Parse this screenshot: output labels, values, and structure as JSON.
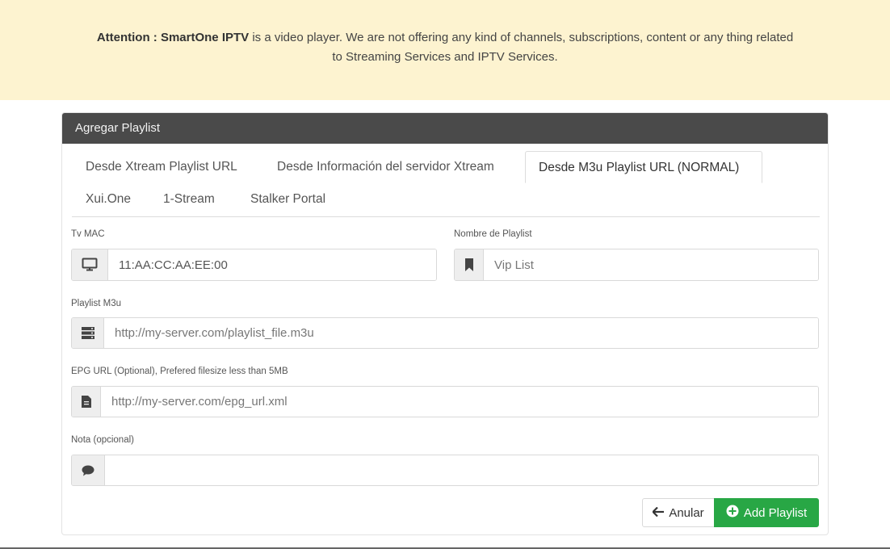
{
  "notice": {
    "prefix": "Attention : SmartOne IPTV",
    "line1": " is a video player. We are not offering any kind of channels, subscriptions, content or any thing related",
    "line2": "to Streaming Services and IPTV Services."
  },
  "panel": {
    "title": "Agregar Playlist",
    "tabs": [
      {
        "label": "Desde Xtream Playlist URL",
        "active": false
      },
      {
        "label": "Desde Información del servidor Xtream",
        "active": false
      },
      {
        "label": "Desde M3u Playlist URL (NORMAL)",
        "active": true
      },
      {
        "label": "Xui.One",
        "active": false
      },
      {
        "label": "1-Stream",
        "active": false
      },
      {
        "label": "Stalker Portal",
        "active": false
      }
    ]
  },
  "form": {
    "mac": {
      "label": "Tv MAC",
      "value": "11:AA:CC:AA:EE:00",
      "icon": "monitor-icon"
    },
    "name": {
      "label": "Nombre de Playlist",
      "placeholder": "Vip List",
      "icon": "bookmark-icon"
    },
    "m3u": {
      "label": "Playlist M3u",
      "placeholder": "http://my-server.com/playlist_file.m3u",
      "icon": "server-icon"
    },
    "epg": {
      "label": "EPG URL (Optional), Prefered filesize less than 5MB",
      "placeholder": "http://my-server.com/epg_url.xml",
      "icon": "file-icon"
    },
    "note": {
      "label": "Nota (opcional)",
      "placeholder": "",
      "icon": "comment-icon"
    }
  },
  "buttons": {
    "cancel": {
      "label": "Anular",
      "icon": "arrow-left-icon"
    },
    "add": {
      "label": "Add Playlist",
      "icon": "plus-circle-icon",
      "color": "#28a745"
    }
  }
}
